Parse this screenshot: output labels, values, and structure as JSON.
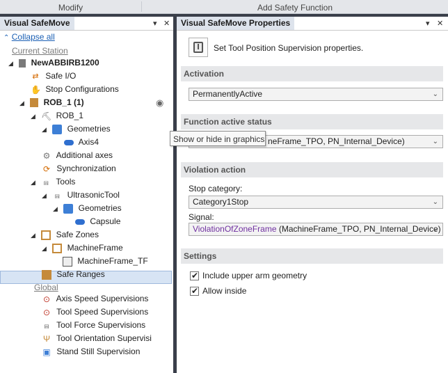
{
  "ribbon": {
    "modify": "Modify",
    "add_safety_function": "Add Safety Function"
  },
  "left_panel": {
    "title": "Visual SafeMove",
    "pin_icon": "▾",
    "close_icon": "✕",
    "collapse_all": "Collapse all",
    "current_station": "Current Station",
    "global": "Global",
    "tree": {
      "station": "NewABBIRB1200",
      "safe_io": "Safe I/O",
      "stop_configurations": "Stop Configurations",
      "rob_1_group": "ROB_1 (1)",
      "rob_1": "ROB_1",
      "geometries": "Geometries",
      "axis4": "Axis4",
      "additional_axes": "Additional axes",
      "synchronization": "Synchronization",
      "tools": "Tools",
      "ultrasonic_tool": "UltrasonicTool",
      "geometries_2": "Geometries",
      "capsule": "Capsule",
      "safe_zones": "Safe Zones",
      "machine_frame": "MachineFrame",
      "machine_frame_tf": "MachineFrame_TF",
      "safe_ranges": "Safe Ranges",
      "axis_speed": "Axis Speed Supervisions",
      "tool_speed": "Tool Speed Supervisions",
      "tool_force": "Tool Force Supervisions",
      "tool_orientation": "Tool Orientation Supervisi",
      "stand_still": "Stand Still Supervision"
    }
  },
  "tooltip": "Show or hide in graphics",
  "right_panel": {
    "title": "Visual SafeMove Properties",
    "header_text": "Set Tool Position Supervision properties.",
    "activation": {
      "label": "Activation",
      "value": "PermanentlyActive"
    },
    "function_active_status": {
      "label": "Function active status",
      "value": "neFrame_TPO, PN_Internal_Device)"
    },
    "violation_action": {
      "label": "Violation action",
      "stop_category_label": "Stop category:",
      "stop_category_value": "Category1Stop",
      "signal_label": "Signal:",
      "signal_name": "ViolationOfZoneFrame",
      "signal_rest": "(MachineFrame_TPO, PN_Internal_Device)"
    },
    "settings": {
      "label": "Settings",
      "include_upper_arm": "Include upper arm geometry",
      "allow_inside": "Allow inside"
    }
  },
  "colors": {
    "accent": "#1a5fb4",
    "selection": "#d7e4f4",
    "signal": "#7030a0",
    "divider": "#3a3f4a"
  }
}
